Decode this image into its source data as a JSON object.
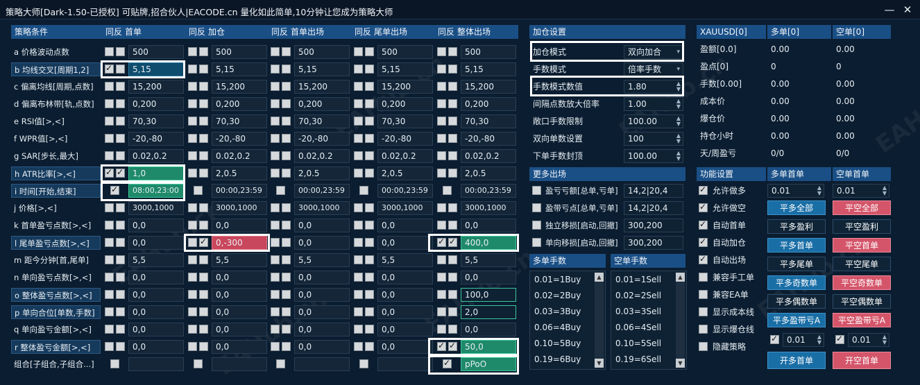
{
  "title": "策略大师[Dark-1.50-已授权]  可贴牌,招合伙人|EACODE.cn  量化如此简单,10分钟让您成为策略大师",
  "window_buttons": {
    "minimize": "—",
    "close": "✕"
  },
  "watermark": "EAHub.cn",
  "grid": {
    "header": {
      "conditions": "策略条件",
      "cols": [
        {
          "sync": "同反",
          "name": "首单"
        },
        {
          "sync": "同反",
          "name": "加仓"
        },
        {
          "sync": "同反",
          "name": "首单出场"
        },
        {
          "sync": "同反",
          "name": "尾单出场"
        },
        {
          "sync": "同反",
          "name": "整体出场"
        }
      ]
    },
    "rows": [
      {
        "label": "a 价格波动点数",
        "vals": [
          "500",
          "500",
          "500",
          "500",
          "500"
        ]
      },
      {
        "label": "b 均线交叉[周期1,2]",
        "vals": [
          "5,15",
          "5,15",
          "5,15",
          "5,15",
          "5,15"
        ]
      },
      {
        "label": "c 偏离均线[周期,点数]",
        "vals": [
          "15,200",
          "15,200",
          "15,200",
          "15,200",
          "15,200"
        ]
      },
      {
        "label": "d 偏离布林带[轨,点数]",
        "vals": [
          "0,200",
          "0,200",
          "0,200",
          "0,200",
          "0,200"
        ]
      },
      {
        "label": "e RSI值[>,<]",
        "vals": [
          "70,30",
          "70,30",
          "70,30",
          "70,30",
          "70,30"
        ]
      },
      {
        "label": "f WPR值[>,<]",
        "vals": [
          "-20,-80",
          "-20,-80",
          "-20,-80",
          "-20,-80",
          "-20,-80"
        ]
      },
      {
        "label": "g SAR[步长,最大]",
        "vals": [
          "0.02,0.2",
          "0.02,0.2",
          "0.02,0.2",
          "0.02,0.2",
          "0.02,0.2"
        ]
      },
      {
        "label": "h ATR比率[>,<]",
        "vals": [
          "1,0",
          "2,0.5",
          "2,0.5",
          "2,0.5",
          "2,0.5"
        ]
      },
      {
        "label": "i 时间[开始,结束]",
        "vals": [
          "08:00,23:00",
          "00:00,23:59",
          "00:00,23:59",
          "00:00,23:59",
          "00:00,23:59"
        ]
      },
      {
        "label": "j 价格[>,<]",
        "vals": [
          "3000,1000",
          "3000,1000",
          "3000,1000",
          "3000,1000",
          "3000,1000"
        ]
      },
      {
        "label": "k 首单盈亏点数[>,<]",
        "vals": [
          "0,0",
          "0,0",
          "0,0",
          "0,0",
          "0,0"
        ]
      },
      {
        "label": "l 尾单盈亏点数[>,<]",
        "vals": [
          "0,0",
          "0,-300",
          "0,0",
          "0,0",
          "400,0"
        ]
      },
      {
        "label": "m 距今分钟[首,尾单]",
        "vals": [
          "5,5",
          "5,5",
          "5,5",
          "5,5",
          "5,5"
        ]
      },
      {
        "label": "n 单向盈亏点数[>,<]",
        "vals": [
          "0,0",
          "0,0",
          "0,0",
          "0,0",
          "0,0"
        ]
      },
      {
        "label": "o 整体盈亏点数[>,<]",
        "vals": [
          "0,0",
          "0,0",
          "0,0",
          "0,0",
          "100,0"
        ]
      },
      {
        "label": "p 单向合位[单数,手数]",
        "vals": [
          "0,0",
          "0,0",
          "0,0",
          "0,0",
          "2,0"
        ]
      },
      {
        "label": "q 单向盈亏金额[>,<]",
        "vals": [
          "0,0",
          "0,0",
          "0,0",
          "0,0",
          "0,0"
        ]
      },
      {
        "label": "r 整体盈亏金额[>,<]",
        "vals": [
          "0,0",
          "0,0",
          "0,0",
          "0,0",
          "50,0"
        ]
      },
      {
        "label": "组合[子组合,子组合...]",
        "vals": [
          "",
          "",
          "",
          "",
          "pPoO"
        ]
      }
    ]
  },
  "add": {
    "title": "加仓设置",
    "rows": [
      {
        "label": "加仓模式",
        "value": "双向加合"
      },
      {
        "label": "手数模式",
        "value": "倍率手数"
      },
      {
        "label": "手数模式数值",
        "value": "1.80"
      },
      {
        "label": "间隔点数放大倍率",
        "value": "1.00"
      },
      {
        "label": "敞口手数限制",
        "value": "100.00"
      },
      {
        "label": "双向单数设置",
        "value": "100"
      },
      {
        "label": "下单手数封顶",
        "value": "100.00"
      }
    ]
  },
  "exit": {
    "title": "更多出场",
    "rows": [
      {
        "label": "盈亏亏额[总单,亏单]",
        "value": "14,2|20,4"
      },
      {
        "label": "盈带亏点[总单,亏单]",
        "value": "14,2|20,4"
      },
      {
        "label": "独立移损[启动,回撤]",
        "value": "300,200"
      },
      {
        "label": "单向移损[启动,回撤]",
        "value": "300,200"
      }
    ]
  },
  "lots": {
    "buy_title": "多单手数",
    "sell_title": "空单手数",
    "buy": [
      "0.01=1Buy",
      "0.02=2Buy",
      "0.03=3Buy",
      "0.06=4Buy",
      "0.10=5Buy",
      "0.19=6Buy"
    ],
    "sell": [
      "0.01=1Sell",
      "0.02=2Sell",
      "0.03=3Sell",
      "0.06=4Sell",
      "0.10=5Sell",
      "0.19=6Sell"
    ]
  },
  "stats": {
    "header": [
      "XAUUSD[0]",
      "多单[0]",
      "空单[0]"
    ],
    "rows": [
      {
        "label": "盈额[0.0]",
        "buy": "0.00",
        "sell": "0.00"
      },
      {
        "label": "盈点[0]",
        "buy": "0",
        "sell": "0"
      },
      {
        "label": "手数[0.00]",
        "buy": "0.00",
        "sell": "0.00"
      },
      {
        "label": "成本价",
        "buy": "0.00",
        "sell": "0.00"
      },
      {
        "label": "爆仓价",
        "buy": "0.00",
        "sell": "0.00"
      },
      {
        "label": "持仓小时",
        "buy": "0.00",
        "sell": "0.00"
      },
      {
        "label": "天/周盈亏",
        "buy": "0/0",
        "sell": "0/0"
      }
    ]
  },
  "func": {
    "header": [
      "功能设置",
      "多单首单",
      "空单首单"
    ],
    "items": [
      "允许做多",
      "允许做空",
      "自动首单",
      "自动加仓",
      "自动出场",
      "兼容手工单",
      "兼容EA单",
      "显示成本线",
      "显示爆仓线",
      "隐藏策略"
    ],
    "buy_lot": "0.01",
    "sell_lot": "0.01",
    "buttons": [
      [
        "平多全部",
        "平空全部"
      ],
      [
        "平多盈利",
        "平空盈利"
      ],
      [
        "平多首单",
        "平空首单"
      ],
      [
        "平多尾单",
        "平空尾单"
      ],
      [
        "平多奇数单",
        "平空奇数单"
      ],
      [
        "平多偶数单",
        "平空偶数单"
      ],
      [
        "平多盈带亏A",
        "平空盈带亏A"
      ]
    ],
    "small_buy": "0.01",
    "small_sell": "0.01",
    "open_buy": "开多首单",
    "open_sell": "开空首单"
  }
}
